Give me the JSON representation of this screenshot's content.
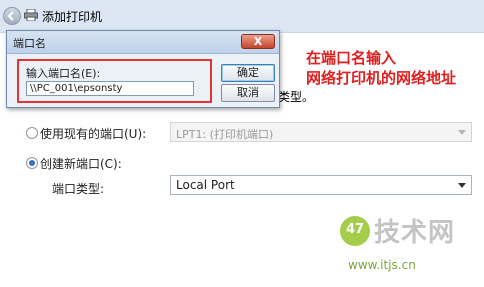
{
  "wizard": {
    "title": "添加打印机",
    "partial_text": "类型。",
    "option_existing": {
      "label": "使用现有的端口(U):",
      "selected": false,
      "value": "LPT1: (打印机端口)"
    },
    "option_new": {
      "label": "创建新端口(C):",
      "selected": true,
      "port_type_label": "端口类型:",
      "port_type_value": "Local Port"
    }
  },
  "dialog": {
    "title": "端口名",
    "close_glyph": "X",
    "field_label": "输入端口名(E):",
    "field_value": "\\\\PC_001\\epsonsty",
    "ok_label": "确定",
    "cancel_label": "取消"
  },
  "annotation": {
    "line1": "在端口名输入",
    "line2": "网络打印机的网络地址"
  },
  "watermark": {
    "badge": "47",
    "brand": "技术网",
    "url": "www.itjs.cn"
  },
  "colors": {
    "annotation_red": "#e02020",
    "highlight_red": "#e33434",
    "title_bar": "#dbe6f2",
    "radio_accent": "#3a6ec6"
  }
}
